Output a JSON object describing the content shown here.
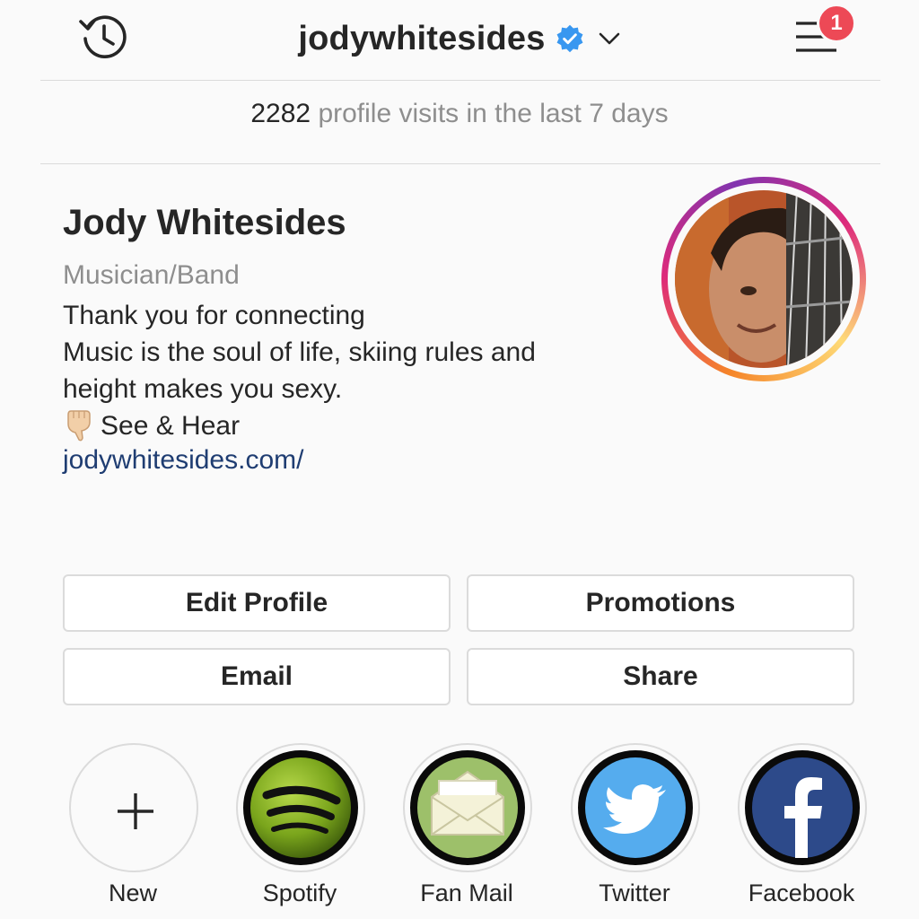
{
  "header": {
    "username": "jodywhitesides",
    "notification_count": "1"
  },
  "insights": {
    "visit_count": "2282",
    "visit_text": " profile visits in the last 7 days"
  },
  "profile": {
    "name": "Jody Whitesides",
    "category": "Musician/Band",
    "bio_lines": [
      "Thank you for connecting",
      "Music is the soul of life, skiing rules and",
      "height makes you sexy."
    ],
    "bio_emoji_line": "See & Hear",
    "website": "jodywhitesides.com/"
  },
  "actions": {
    "edit_profile": "Edit Profile",
    "promotions": "Promotions",
    "email": "Email",
    "share": "Share"
  },
  "highlights": [
    {
      "label": "New",
      "icon": "plus-icon"
    },
    {
      "label": "Spotify",
      "icon": "spotify-logo"
    },
    {
      "label": "Fan Mail",
      "icon": "envelope-icon"
    },
    {
      "label": "Twitter",
      "icon": "twitter-bird-icon"
    },
    {
      "label": "Facebook",
      "icon": "facebook-f-icon"
    }
  ],
  "colors": {
    "verified_blue": "#3897f0",
    "badge_red": "#ed4956",
    "link_blue": "#1f3d72",
    "muted_gray": "#8e8e8e"
  }
}
